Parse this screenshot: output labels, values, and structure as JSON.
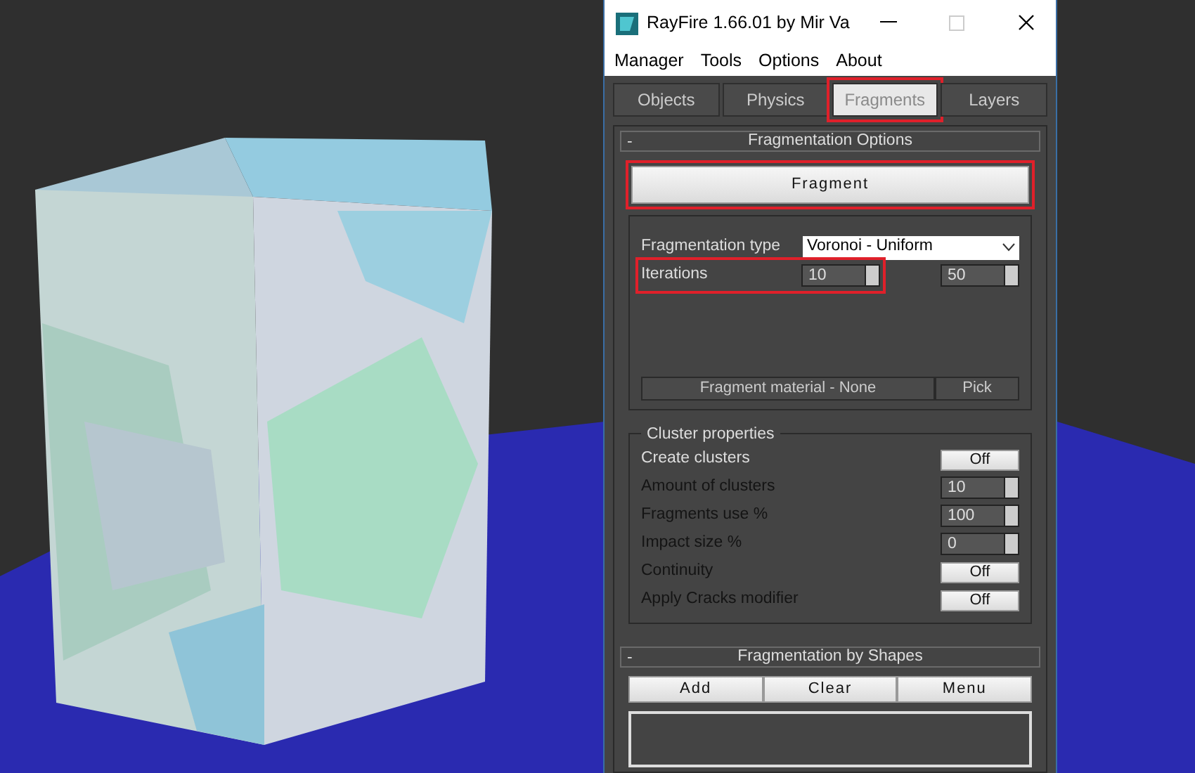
{
  "window": {
    "title": "RayFire 1.66.01  by Mir Va"
  },
  "menu": [
    "Manager",
    "Tools",
    "Options",
    "About"
  ],
  "tabs": [
    {
      "label": "Objects",
      "selected": false,
      "highlighted": false
    },
    {
      "label": "Physics",
      "selected": false,
      "highlighted": false
    },
    {
      "label": "Fragments",
      "selected": true,
      "highlighted": true
    },
    {
      "label": "Layers",
      "selected": false,
      "highlighted": false
    }
  ],
  "fragmentation_options": {
    "collapse": "-",
    "title": "Fragmentation Options",
    "fragment_button": {
      "label": "Fragment",
      "highlighted": true
    },
    "type_label": "Fragmentation type",
    "type_value": "Voronoi - Uniform",
    "iterations": {
      "label": "Iterations",
      "value": "10",
      "value_2": "50",
      "highlighted": true
    },
    "material": "Fragment material - None",
    "pick": "Pick"
  },
  "cluster_properties": {
    "title": "Cluster properties",
    "rows": [
      {
        "kind": "toggle",
        "label": "Create clusters",
        "value": "Off",
        "disabled": false
      },
      {
        "kind": "spinner",
        "label": "Amount of clusters",
        "value": "10",
        "disabled": true
      },
      {
        "kind": "spinner",
        "label": "Fragments use %",
        "value": "100",
        "disabled": true
      },
      {
        "kind": "spinner",
        "label": "Impact size %",
        "value": "0",
        "disabled": true
      },
      {
        "kind": "toggle",
        "label": "Continuity",
        "value": "Off",
        "disabled": true
      },
      {
        "kind": "toggle",
        "label": "Apply Cracks modifier",
        "value": "Off",
        "disabled": true
      }
    ]
  },
  "fragmentation_by_shapes": {
    "collapse": "-",
    "title": "Fragmentation by Shapes",
    "buttons": [
      "Add",
      "Clear",
      "Menu"
    ]
  }
}
